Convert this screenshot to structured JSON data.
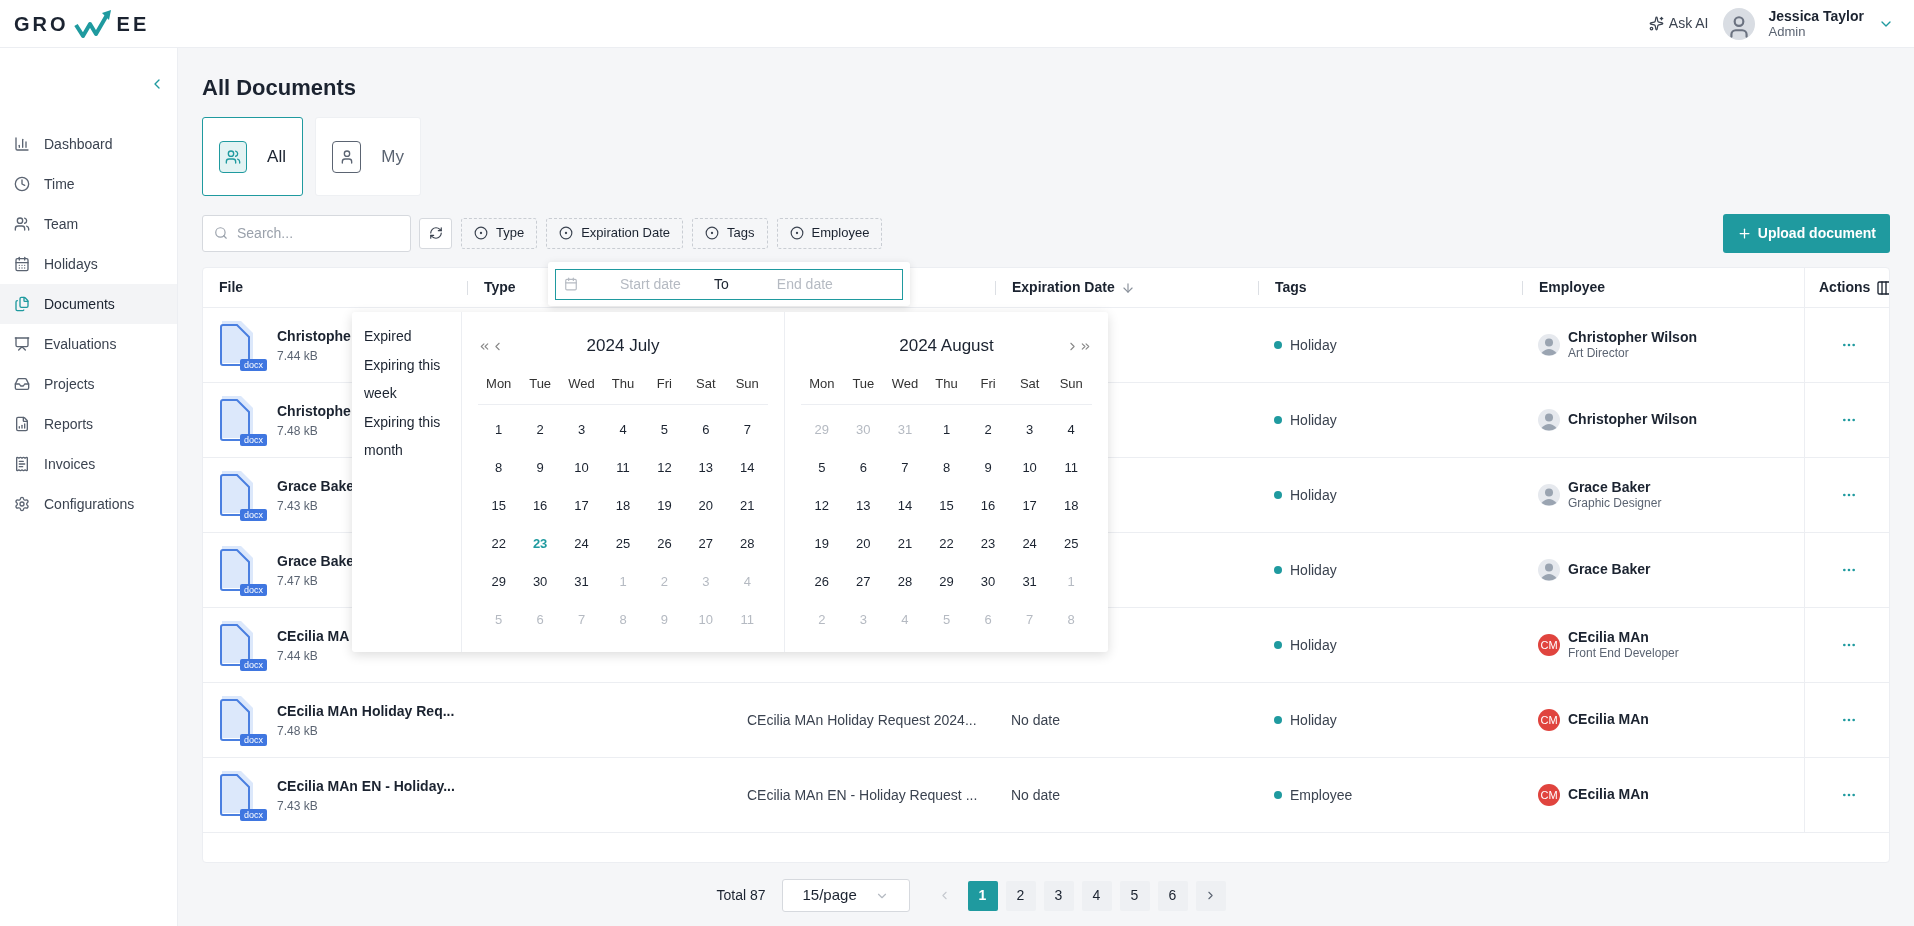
{
  "logo": {
    "left": "GRO",
    "right": "EE"
  },
  "header": {
    "ask_ai": "Ask AI",
    "user": {
      "name": "Jessica Taylor",
      "role": "Admin"
    }
  },
  "sidebar": {
    "items": [
      {
        "label": "Dashboard",
        "selected": false
      },
      {
        "label": "Time",
        "selected": false
      },
      {
        "label": "Team",
        "selected": false
      },
      {
        "label": "Holidays",
        "selected": false
      },
      {
        "label": "Documents",
        "selected": true
      },
      {
        "label": "Evaluations",
        "selected": false
      },
      {
        "label": "Projects",
        "selected": false
      },
      {
        "label": "Reports",
        "selected": false
      },
      {
        "label": "Invoices",
        "selected": false
      },
      {
        "label": "Configurations",
        "selected": false
      }
    ]
  },
  "page_title": "All Documents",
  "scope_tabs": [
    {
      "label": "All",
      "selected": true
    },
    {
      "label": "My",
      "selected": false
    }
  ],
  "search": {
    "placeholder": "Search..."
  },
  "filters": [
    "Type",
    "Expiration Date",
    "Tags",
    "Employee"
  ],
  "upload_button": "Upload document",
  "table": {
    "columns": [
      {
        "label": "File",
        "sorted": false
      },
      {
        "label": "Type",
        "sorted": false
      },
      {
        "label": "Expiration Date",
        "sorted": true
      },
      {
        "label": "Tags",
        "sorted": false
      },
      {
        "label": "Employee",
        "sorted": false
      },
      {
        "label": "Actions",
        "sorted": false
      }
    ],
    "rows": [
      {
        "file": "Christophe",
        "size": "7.44 kB",
        "ext": "docx",
        "tag": "Holiday",
        "employee": "Christopher Wilson",
        "role": "Art Director",
        "avatar": {
          "kind": "photo"
        }
      },
      {
        "file": "Christophe",
        "size": "7.48 kB",
        "ext": "docx",
        "tag": "Holiday",
        "employee": "Christopher Wilson",
        "avatar": {
          "kind": "photo"
        }
      },
      {
        "file": "Grace Bake",
        "size": "7.43 kB",
        "ext": "docx",
        "tag": "Holiday",
        "employee": "Grace Baker",
        "role": "Graphic Designer",
        "avatar": {
          "kind": "photo"
        }
      },
      {
        "file": "Grace Bake",
        "size": "7.47 kB",
        "ext": "docx",
        "tag": "Holiday",
        "employee": "Grace Baker",
        "avatar": {
          "kind": "photo"
        }
      },
      {
        "file": "CEcilia MA",
        "size": "7.44 kB",
        "ext": "docx",
        "tag": "Holiday",
        "employee": "CEcilia MAn",
        "role": "Front End Developer",
        "avatar": {
          "kind": "initials",
          "initials": "CM"
        }
      },
      {
        "file": "CEcilia MAn Holiday Req...",
        "size": "7.48 kB",
        "ext": "docx",
        "column_3": "CEcilia MAn Holiday Request 2024...",
        "expiration": "No date",
        "tag": "Holiday",
        "employee": "CEcilia MAn",
        "avatar": {
          "kind": "initials",
          "initials": "CM"
        }
      },
      {
        "file": "CEcilia MAn EN - Holiday...",
        "size": "7.43 kB",
        "ext": "docx",
        "column_3": "CEcilia MAn EN - Holiday Request ...",
        "expiration": "No date",
        "tag": "Employee",
        "employee": "CEcilia MAn",
        "avatar": {
          "kind": "initials",
          "initials": "CM"
        }
      }
    ]
  },
  "pagination": {
    "total": "Total 87",
    "page_size": "15/page",
    "pages": [
      {
        "label": "1",
        "selected": true
      },
      {
        "label": "2",
        "selected": false
      },
      {
        "label": "3",
        "selected": false
      },
      {
        "label": "4",
        "selected": false
      },
      {
        "label": "5",
        "selected": false
      },
      {
        "label": "6",
        "selected": false
      }
    ]
  },
  "date_range": {
    "start_placeholder": "Start date",
    "separator": "To",
    "end_placeholder": "End date",
    "presets": [
      "Expired",
      "Expiring this week",
      "Expiring this month"
    ],
    "months": [
      {
        "title": "2024 July",
        "weekdays": [
          "Mon",
          "Tue",
          "Wed",
          "Thu",
          "Fri",
          "Sat",
          "Sun"
        ],
        "days": [
          {
            "d": "1",
            "kind": "current"
          },
          {
            "d": "2",
            "kind": "current"
          },
          {
            "d": "3",
            "kind": "current"
          },
          {
            "d": "4",
            "kind": "current"
          },
          {
            "d": "5",
            "kind": "current"
          },
          {
            "d": "6",
            "kind": "current"
          },
          {
            "d": "7",
            "kind": "current"
          },
          {
            "d": "8",
            "kind": "current"
          },
          {
            "d": "9",
            "kind": "current"
          },
          {
            "d": "10",
            "kind": "current"
          },
          {
            "d": "11",
            "kind": "current"
          },
          {
            "d": "12",
            "kind": "current"
          },
          {
            "d": "13",
            "kind": "current"
          },
          {
            "d": "14",
            "kind": "current"
          },
          {
            "d": "15",
            "kind": "current"
          },
          {
            "d": "16",
            "kind": "current"
          },
          {
            "d": "17",
            "kind": "current"
          },
          {
            "d": "18",
            "kind": "current"
          },
          {
            "d": "19",
            "kind": "current"
          },
          {
            "d": "20",
            "kind": "current"
          },
          {
            "d": "21",
            "kind": "current"
          },
          {
            "d": "22",
            "kind": "current"
          },
          {
            "d": "23",
            "kind": "today"
          },
          {
            "d": "24",
            "kind": "current"
          },
          {
            "d": "25",
            "kind": "current"
          },
          {
            "d": "26",
            "kind": "current"
          },
          {
            "d": "27",
            "kind": "current"
          },
          {
            "d": "28",
            "kind": "current"
          },
          {
            "d": "29",
            "kind": "current"
          },
          {
            "d": "30",
            "kind": "current"
          },
          {
            "d": "31",
            "kind": "current"
          },
          {
            "d": "1",
            "kind": "outside"
          },
          {
            "d": "2",
            "kind": "outside"
          },
          {
            "d": "3",
            "kind": "outside"
          },
          {
            "d": "4",
            "kind": "outside"
          },
          {
            "d": "5",
            "kind": "outside"
          },
          {
            "d": "6",
            "kind": "outside"
          },
          {
            "d": "7",
            "kind": "outside"
          },
          {
            "d": "8",
            "kind": "outside"
          },
          {
            "d": "9",
            "kind": "outside"
          },
          {
            "d": "10",
            "kind": "outside"
          },
          {
            "d": "11",
            "kind": "outside"
          }
        ]
      },
      {
        "title": "2024 August",
        "weekdays": [
          "Mon",
          "Tue",
          "Wed",
          "Thu",
          "Fri",
          "Sat",
          "Sun"
        ],
        "days": [
          {
            "d": "29",
            "kind": "outside"
          },
          {
            "d": "30",
            "kind": "outside"
          },
          {
            "d": "31",
            "kind": "outside"
          },
          {
            "d": "1",
            "kind": "current"
          },
          {
            "d": "2",
            "kind": "current"
          },
          {
            "d": "3",
            "kind": "current"
          },
          {
            "d": "4",
            "kind": "current"
          },
          {
            "d": "5",
            "kind": "current"
          },
          {
            "d": "6",
            "kind": "current"
          },
          {
            "d": "7",
            "kind": "current"
          },
          {
            "d": "8",
            "kind": "current"
          },
          {
            "d": "9",
            "kind": "current"
          },
          {
            "d": "10",
            "kind": "current"
          },
          {
            "d": "11",
            "kind": "current"
          },
          {
            "d": "12",
            "kind": "current"
          },
          {
            "d": "13",
            "kind": "current"
          },
          {
            "d": "14",
            "kind": "current"
          },
          {
            "d": "15",
            "kind": "current"
          },
          {
            "d": "16",
            "kind": "current"
          },
          {
            "d": "17",
            "kind": "current"
          },
          {
            "d": "18",
            "kind": "current"
          },
          {
            "d": "19",
            "kind": "current"
          },
          {
            "d": "20",
            "kind": "current"
          },
          {
            "d": "21",
            "kind": "current"
          },
          {
            "d": "22",
            "kind": "current"
          },
          {
            "d": "23",
            "kind": "current"
          },
          {
            "d": "24",
            "kind": "current"
          },
          {
            "d": "25",
            "kind": "current"
          },
          {
            "d": "26",
            "kind": "current"
          },
          {
            "d": "27",
            "kind": "current"
          },
          {
            "d": "28",
            "kind": "current"
          },
          {
            "d": "29",
            "kind": "current"
          },
          {
            "d": "30",
            "kind": "current"
          },
          {
            "d": "31",
            "kind": "current"
          },
          {
            "d": "1",
            "kind": "outside"
          },
          {
            "d": "2",
            "kind": "outside"
          },
          {
            "d": "3",
            "kind": "outside"
          },
          {
            "d": "4",
            "kind": "outside"
          },
          {
            "d": "5",
            "kind": "outside"
          },
          {
            "d": "6",
            "kind": "outside"
          },
          {
            "d": "7",
            "kind": "outside"
          },
          {
            "d": "8",
            "kind": "outside"
          }
        ]
      }
    ]
  }
}
